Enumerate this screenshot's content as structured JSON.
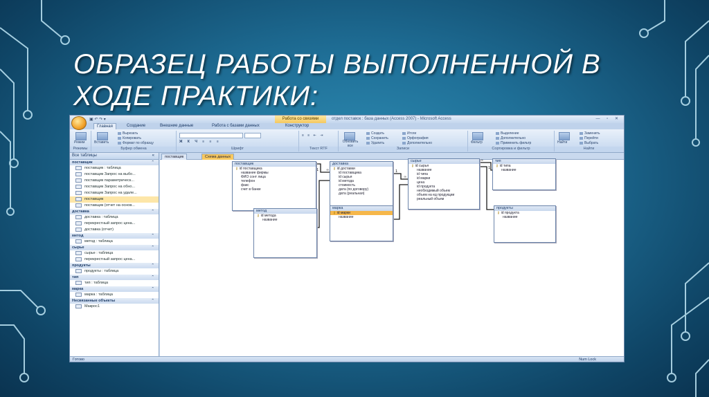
{
  "slide": {
    "title": "Образец работы выполненной в ходе практики:"
  },
  "window": {
    "context_tab": "Работа со связями",
    "title": "отдел поставок : база данных (Access 2007) - Microsoft Access",
    "controls": "— ▫ ✕"
  },
  "ribbon_tabs": [
    "Главная",
    "Создание",
    "Внешние данные",
    "Работа с базами данных",
    "Конструктор"
  ],
  "ribbon": {
    "groups": {
      "views": "Режимы",
      "clipboard": "Буфер обмена",
      "font": "Шрифт",
      "rtf": "Текст RTF",
      "records": "Записи",
      "sort": "Сортировка и фильтр",
      "find": "Найти"
    },
    "buttons": {
      "view": "Режим",
      "paste": "Вставить",
      "cut": "Вырезать",
      "copy": "Копировать",
      "format_painter": "Формат по образцу",
      "refresh": "Обновить все",
      "new": "Создать",
      "save": "Сохранить",
      "delete": "Удалить",
      "totals": "Итоги",
      "spelling": "Орфография",
      "more": "Дополнительно",
      "filter": "Фильтр",
      "selection": "Выделение",
      "advanced": "Дополнительно",
      "toggle_filter": "Применить фильтр",
      "find": "Найти",
      "replace": "Заменить",
      "goto": "Перейти",
      "select": "Выбрать"
    }
  },
  "nav": {
    "header": "Все таблицы",
    "groups": [
      {
        "name": "поставщик",
        "items": [
          {
            "label": "поставщик : таблица",
            "selected": false
          },
          {
            "label": "поставщик Запрос на выбо...",
            "selected": false
          },
          {
            "label": "поставщик параметрическ...",
            "selected": false
          },
          {
            "label": "поставщик Запрос на обно...",
            "selected": false
          },
          {
            "label": "поставщик Запрос на удале...",
            "selected": false
          },
          {
            "label": "поставщик",
            "selected": true
          },
          {
            "label": "поставщик (отчет на основ...",
            "selected": false
          }
        ]
      },
      {
        "name": "доставка",
        "items": [
          {
            "label": "доставка : таблица",
            "selected": false
          },
          {
            "label": "перекрестный запрос цена...",
            "selected": false
          },
          {
            "label": "доставка (отчет)",
            "selected": false
          }
        ]
      },
      {
        "name": "метод",
        "items": [
          {
            "label": "метод : таблица",
            "selected": false
          }
        ]
      },
      {
        "name": "сырье",
        "items": [
          {
            "label": "сырье : таблица",
            "selected": false
          },
          {
            "label": "перекрестный запрос цена...",
            "selected": false
          }
        ]
      },
      {
        "name": "продукты",
        "items": [
          {
            "label": "продукты : таблица",
            "selected": false
          }
        ]
      },
      {
        "name": "тип",
        "items": [
          {
            "label": "тип : таблица",
            "selected": false
          }
        ]
      },
      {
        "name": "марка",
        "items": [
          {
            "label": "марка : таблица",
            "selected": false
          }
        ]
      },
      {
        "name": "Несвязанные объекты",
        "items": [
          {
            "label": "Макрос1",
            "selected": false
          }
        ]
      }
    ]
  },
  "doc_tabs": [
    {
      "label": "поставщик",
      "active": false
    },
    {
      "label": "Схема данных",
      "active": true
    }
  ],
  "tables": [
    {
      "name": "поставщик",
      "fields": [
        "id поставщика",
        "название фирмы",
        "ФИО сонт лица",
        "телефон",
        "факс",
        "счет в банке"
      ],
      "key": 0,
      "selected": -1
    },
    {
      "name": "доставка",
      "fields": [
        "id доставки",
        "id поставщика",
        "id сырья",
        "id метода",
        "стоимость",
        "дата (по договору)",
        "дата (реальная)"
      ],
      "key": 0,
      "selected": -1
    },
    {
      "name": "сырье",
      "fields": [
        "id сырья",
        "название",
        "id типа",
        "id марки",
        "цена",
        "id продукта",
        "необходимый объем",
        "объем на ед продукции",
        "реальный объем"
      ],
      "key": 0,
      "selected": -1
    },
    {
      "name": "тип",
      "fields": [
        "id типа",
        "название"
      ],
      "key": 0,
      "selected": -1
    },
    {
      "name": "метод",
      "fields": [
        "id метода",
        "название"
      ],
      "key": 0,
      "selected": -1
    },
    {
      "name": "марка",
      "fields": [
        "id марки",
        "название"
      ],
      "key": 0,
      "selected": 0
    },
    {
      "name": "продукты",
      "fields": [
        "id продукта",
        "название"
      ],
      "key": 0,
      "selected": -1
    }
  ],
  "status": {
    "left": "Готово",
    "right": "Num Lock"
  },
  "colors": {
    "background": "#1f6f97",
    "selection": "#f6b74a"
  }
}
